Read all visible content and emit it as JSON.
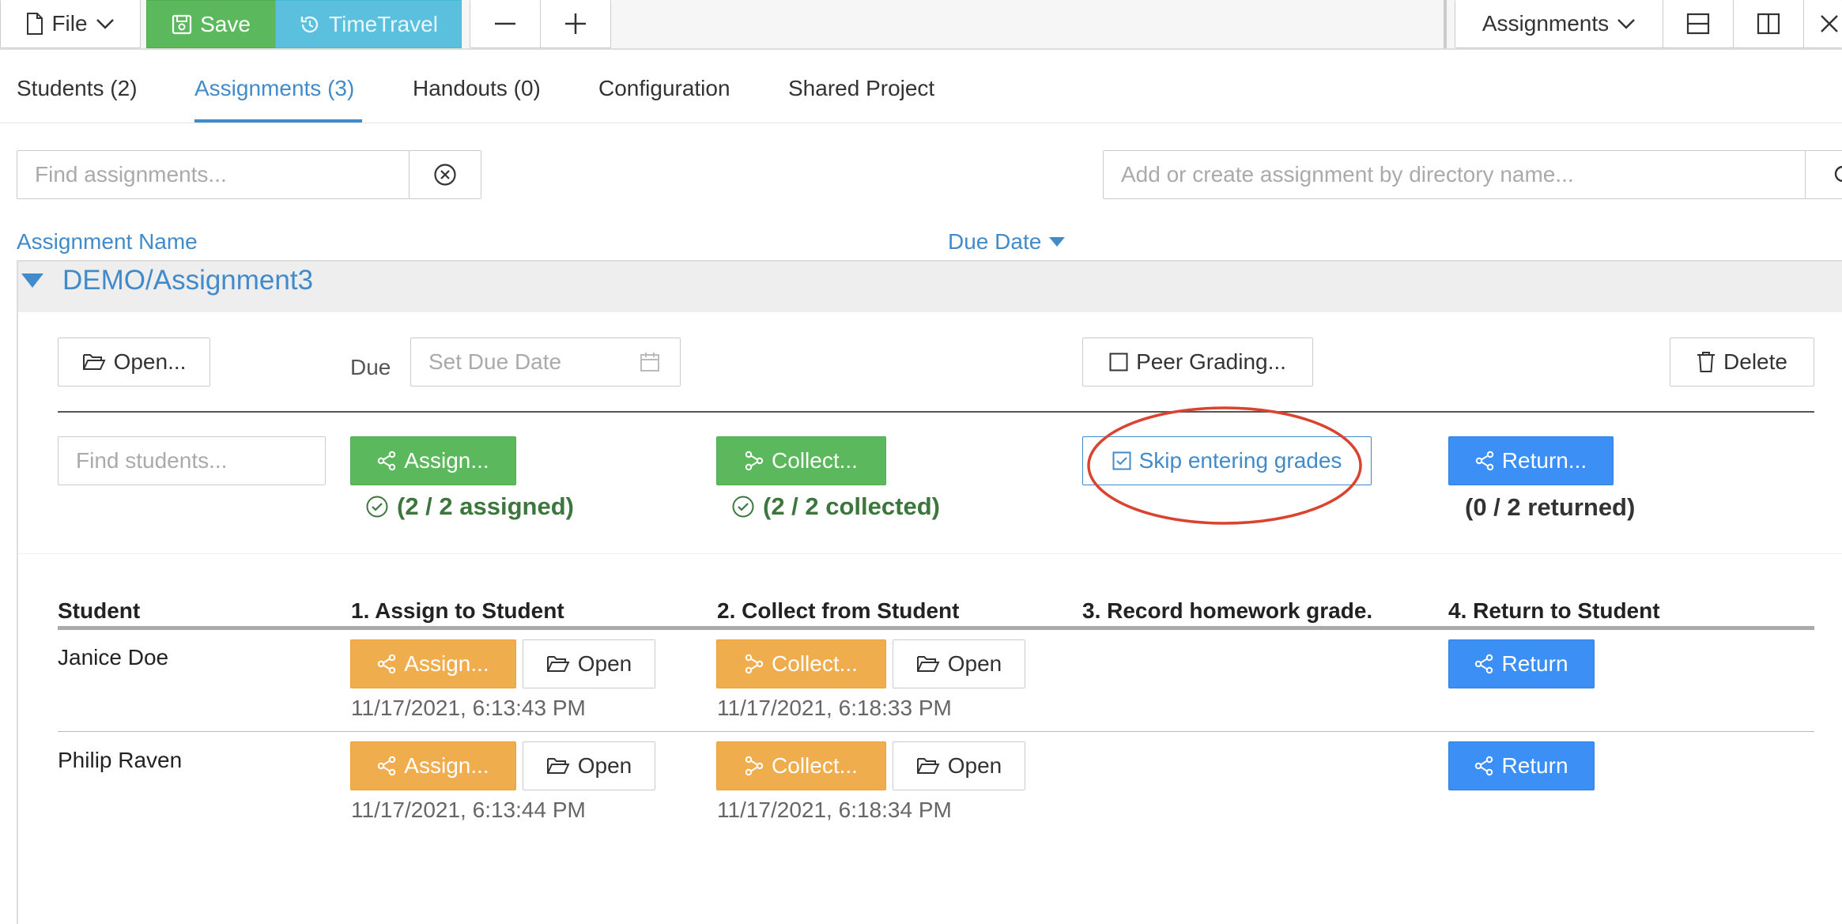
{
  "toolbar": {
    "file_label": "File",
    "save_label": "Save",
    "timetravel_label": "TimeTravel",
    "view_label": "Assignments"
  },
  "tabs": [
    {
      "label": "Students (2)"
    },
    {
      "label": "Assignments (3)",
      "active": true
    },
    {
      "label": "Handouts (0)"
    },
    {
      "label": "Configuration"
    },
    {
      "label": "Shared Project"
    }
  ],
  "search": {
    "find_placeholder": "Find assignments...",
    "add_placeholder": "Add or create assignment by directory name..."
  },
  "columns": {
    "name": "Assignment Name",
    "due": "Due Date"
  },
  "assignment": {
    "title": "DEMO/Assignment3",
    "open_label": "Open...",
    "due_label": "Due",
    "due_placeholder": "Set Due Date",
    "peer_label": "Peer Grading...",
    "delete_label": "Delete",
    "find_students_placeholder": "Find students...",
    "assign_label": "Assign...",
    "assign_status": "(2 / 2 assigned)",
    "collect_label": "Collect...",
    "collect_status": "(2 / 2 collected)",
    "skip_label": "Skip entering grades",
    "return_label": "Return...",
    "return_status": "(0 / 2 returned)"
  },
  "table": {
    "headers": [
      "Student",
      "1. Assign to Student",
      "2. Collect from Student",
      "3. Record homework grade.",
      "4. Return to Student"
    ],
    "rows": [
      {
        "name": "Janice Doe",
        "assign": "Assign...",
        "open1": "Open",
        "assign_time": "11/17/2021, 6:13:43 PM",
        "collect": "Collect...",
        "open2": "Open",
        "collect_time": "11/17/2021, 6:18:33 PM",
        "return": "Return"
      },
      {
        "name": "Philip Raven",
        "assign": "Assign...",
        "open1": "Open",
        "assign_time": "11/17/2021, 6:13:44 PM",
        "collect": "Collect...",
        "open2": "Open",
        "collect_time": "11/17/2021, 6:18:34 PM",
        "return": "Return"
      }
    ]
  },
  "colors": {
    "accent": "#428bca",
    "success": "#5cb85c",
    "warning": "#f0ad4e",
    "highlight_circle": "#d9432f"
  }
}
